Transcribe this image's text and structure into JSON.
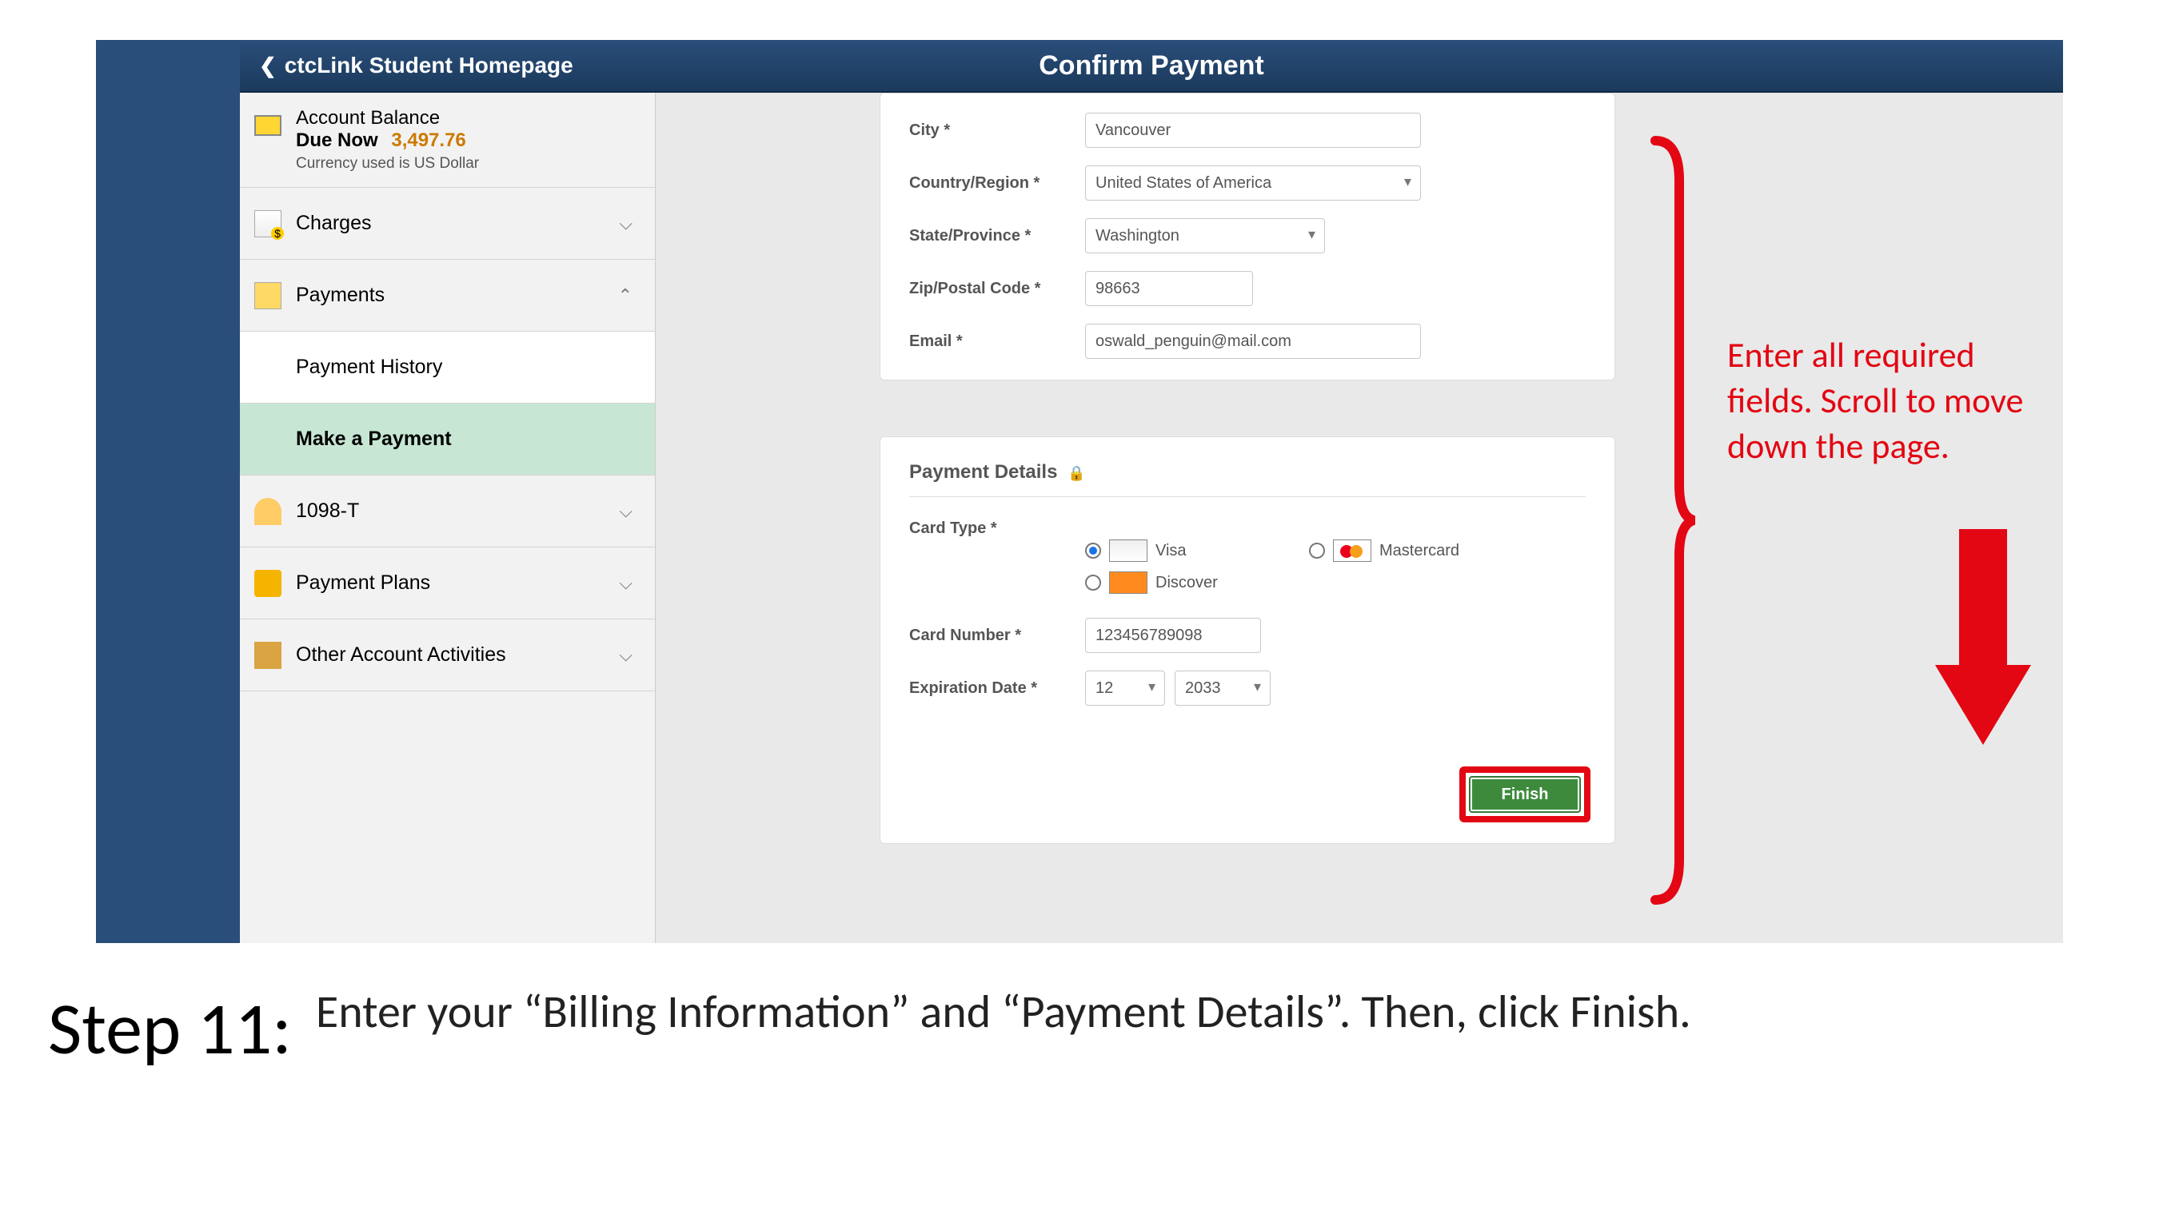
{
  "header": {
    "back_label": "ctcLink Student Homepage",
    "title": "Confirm Payment"
  },
  "balance": {
    "label": "Account Balance",
    "due_label": "Due Now",
    "amount": "3,497.76",
    "currency_note": "Currency used is US Dollar"
  },
  "nav": {
    "charges": "Charges",
    "payments": "Payments",
    "payment_history": "Payment History",
    "make_payment": "Make a Payment",
    "t1098": "1098-T",
    "payment_plans": "Payment Plans",
    "other_activities": "Other Account Activities"
  },
  "billing": {
    "city_label": "City *",
    "city_value": "Vancouver",
    "country_label": "Country/Region *",
    "country_value": "United States of America",
    "state_label": "State/Province *",
    "state_value": "Washington",
    "zip_label": "Zip/Postal Code *",
    "zip_value": "98663",
    "email_label": "Email *",
    "email_value": "oswald_penguin@mail.com"
  },
  "payment": {
    "section_title": "Payment Details",
    "card_type_label": "Card Type *",
    "options": {
      "visa": "Visa",
      "mastercard": "Mastercard",
      "discover": "Discover"
    },
    "card_number_label": "Card Number *",
    "card_number_value": "123456789098",
    "exp_label": "Expiration Date *",
    "exp_month": "12",
    "exp_year": "2033",
    "finish_label": "Finish"
  },
  "annotation": {
    "text": "Enter all required fields. Scroll to move down the page."
  },
  "step": {
    "label": "Step 11:",
    "body_part1": "Enter your “",
    "body_b1": "Billing Information",
    "body_mid": "” and “",
    "body_b2": "Payment Details",
    "body_tail": "”. Then, click ",
    "body_b3": "Finish",
    "body_end": "."
  }
}
